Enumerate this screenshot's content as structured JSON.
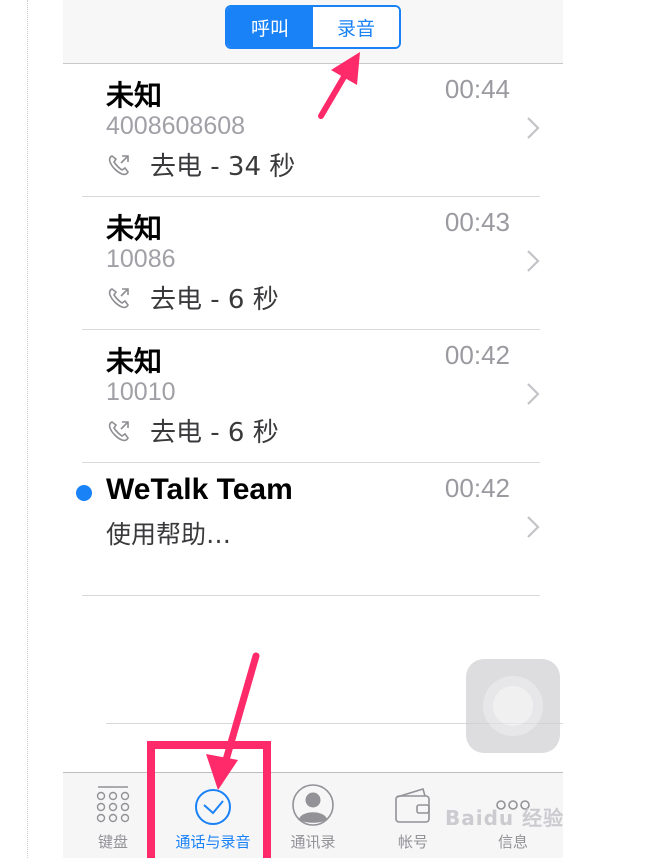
{
  "segment": {
    "calls_label": "呼叫",
    "recordings_label": "录音"
  },
  "calls": [
    {
      "name": "未知",
      "time": "00:44",
      "number": "4008608608",
      "detail": "去电 - 34 秒"
    },
    {
      "name": "未知",
      "time": "00:43",
      "number": "10086",
      "detail": "去电 - 6 秒"
    },
    {
      "name": "未知",
      "time": "00:42",
      "number": "10010",
      "detail": "去电 - 6 秒"
    },
    {
      "name": "WeTalk Team",
      "time": "00:42",
      "preview": "使用帮助…",
      "unread": true
    }
  ],
  "tabs": [
    {
      "label": "键盘",
      "icon": "keypad-icon"
    },
    {
      "label": "通话与录音",
      "icon": "recents-clock-icon",
      "active": true
    },
    {
      "label": "通讯录",
      "icon": "contacts-icon"
    },
    {
      "label": "帐号",
      "icon": "wallet-icon"
    },
    {
      "label": "信息",
      "icon": "more-dots-icon"
    }
  ],
  "watermark": "Baidu 经验",
  "colors": {
    "accent": "#1a82f7",
    "annotation": "#ff2a6a"
  }
}
